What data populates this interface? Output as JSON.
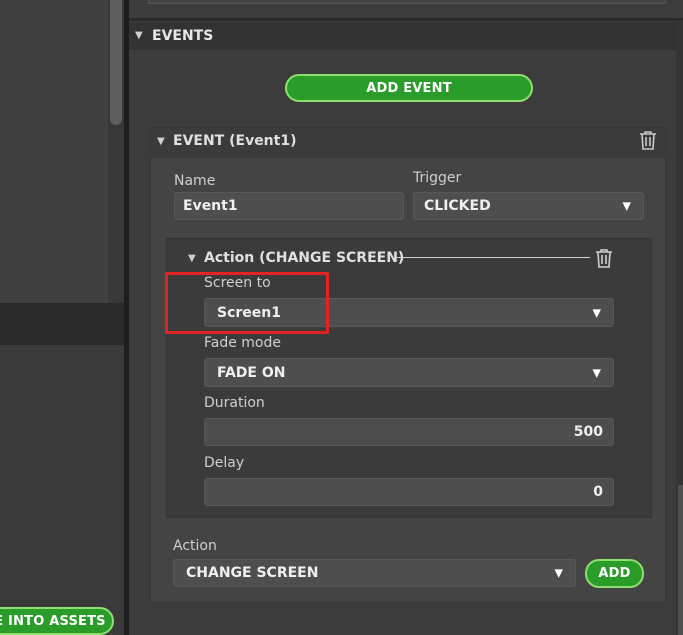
{
  "left_panel": {
    "bottom_button_label": "E INTO ASSETS"
  },
  "events_section": {
    "title": "EVENTS",
    "add_event_label": "ADD EVENT"
  },
  "event": {
    "title": "EVENT (Event1)",
    "name_label": "Name",
    "name_value": "Event1",
    "trigger_label": "Trigger",
    "trigger_value": "CLICKED"
  },
  "action": {
    "title": "Action (CHANGE SCREEN)",
    "screen_to_label": "Screen to",
    "screen_to_value": "Screen1",
    "fade_mode_label": "Fade mode",
    "fade_mode_value": "FADE ON",
    "duration_label": "Duration",
    "duration_value": "500",
    "delay_label": "Delay",
    "delay_value": "0"
  },
  "new_action": {
    "label": "Action",
    "value": "CHANGE SCREEN",
    "add_label": "ADD"
  },
  "icons": {
    "collapse": "caret-down-icon",
    "delete": "trash-icon",
    "dropdown": "dropdown-arrow-icon"
  },
  "colors": {
    "green_button": "#2a9c2a",
    "green_border": "#8fde6f",
    "highlight": "#e02424"
  }
}
